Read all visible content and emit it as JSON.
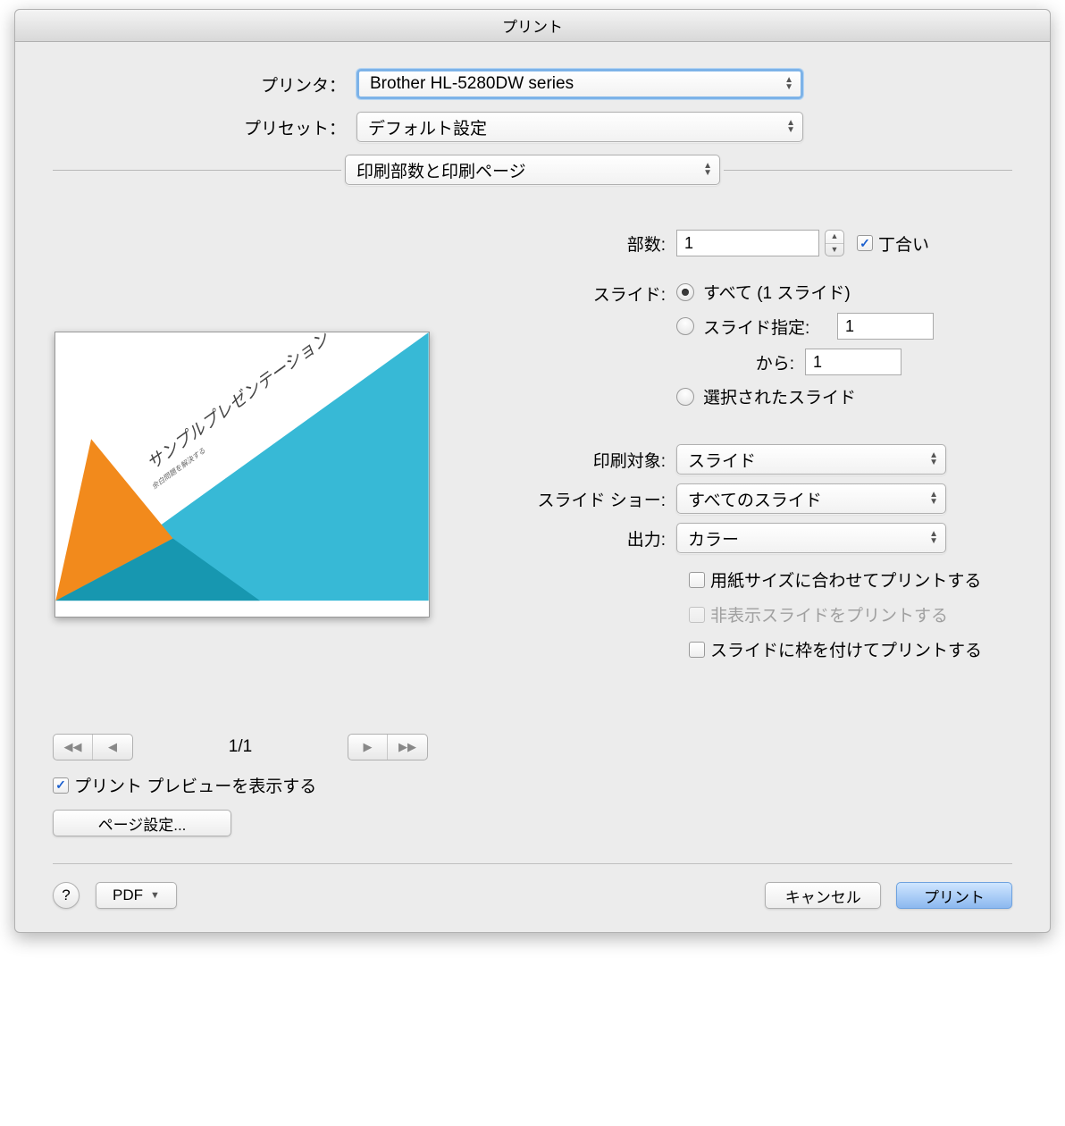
{
  "title": "プリント",
  "printer": {
    "label": "プリンタ：",
    "value": "Brother HL-5280DW series"
  },
  "preset": {
    "label": "プリセット：",
    "value": "デフォルト設定"
  },
  "section": {
    "value": "印刷部数と印刷ページ"
  },
  "copies": {
    "label": "部数:",
    "value": "1",
    "collate": "丁合い"
  },
  "slides": {
    "label": "スライド:",
    "all": "すべて  (1 スライド)",
    "range": "スライド指定:",
    "range_value": "1",
    "from_label": "から:",
    "from_value": "1",
    "selected": "選択されたスライド"
  },
  "print_target": {
    "label": "印刷対象:",
    "value": "スライド"
  },
  "slideshow": {
    "label": "スライド ショー:",
    "value": "すべてのスライド"
  },
  "output": {
    "label": "出力:",
    "value": "カラー"
  },
  "checks": {
    "fit": "用紙サイズに合わせてプリントする",
    "hidden": "非表示スライドをプリントする",
    "frame": "スライドに枠を付けてプリントする"
  },
  "preview": {
    "title": "サンプルプレゼンテーション",
    "subtitle": "余白問題を解決する"
  },
  "pager": {
    "display": "1/1"
  },
  "show_preview": "プリント プレビューを表示する",
  "page_setup": "ページ設定...",
  "pdf": "PDF",
  "cancel": "キャンセル",
  "print": "プリント"
}
